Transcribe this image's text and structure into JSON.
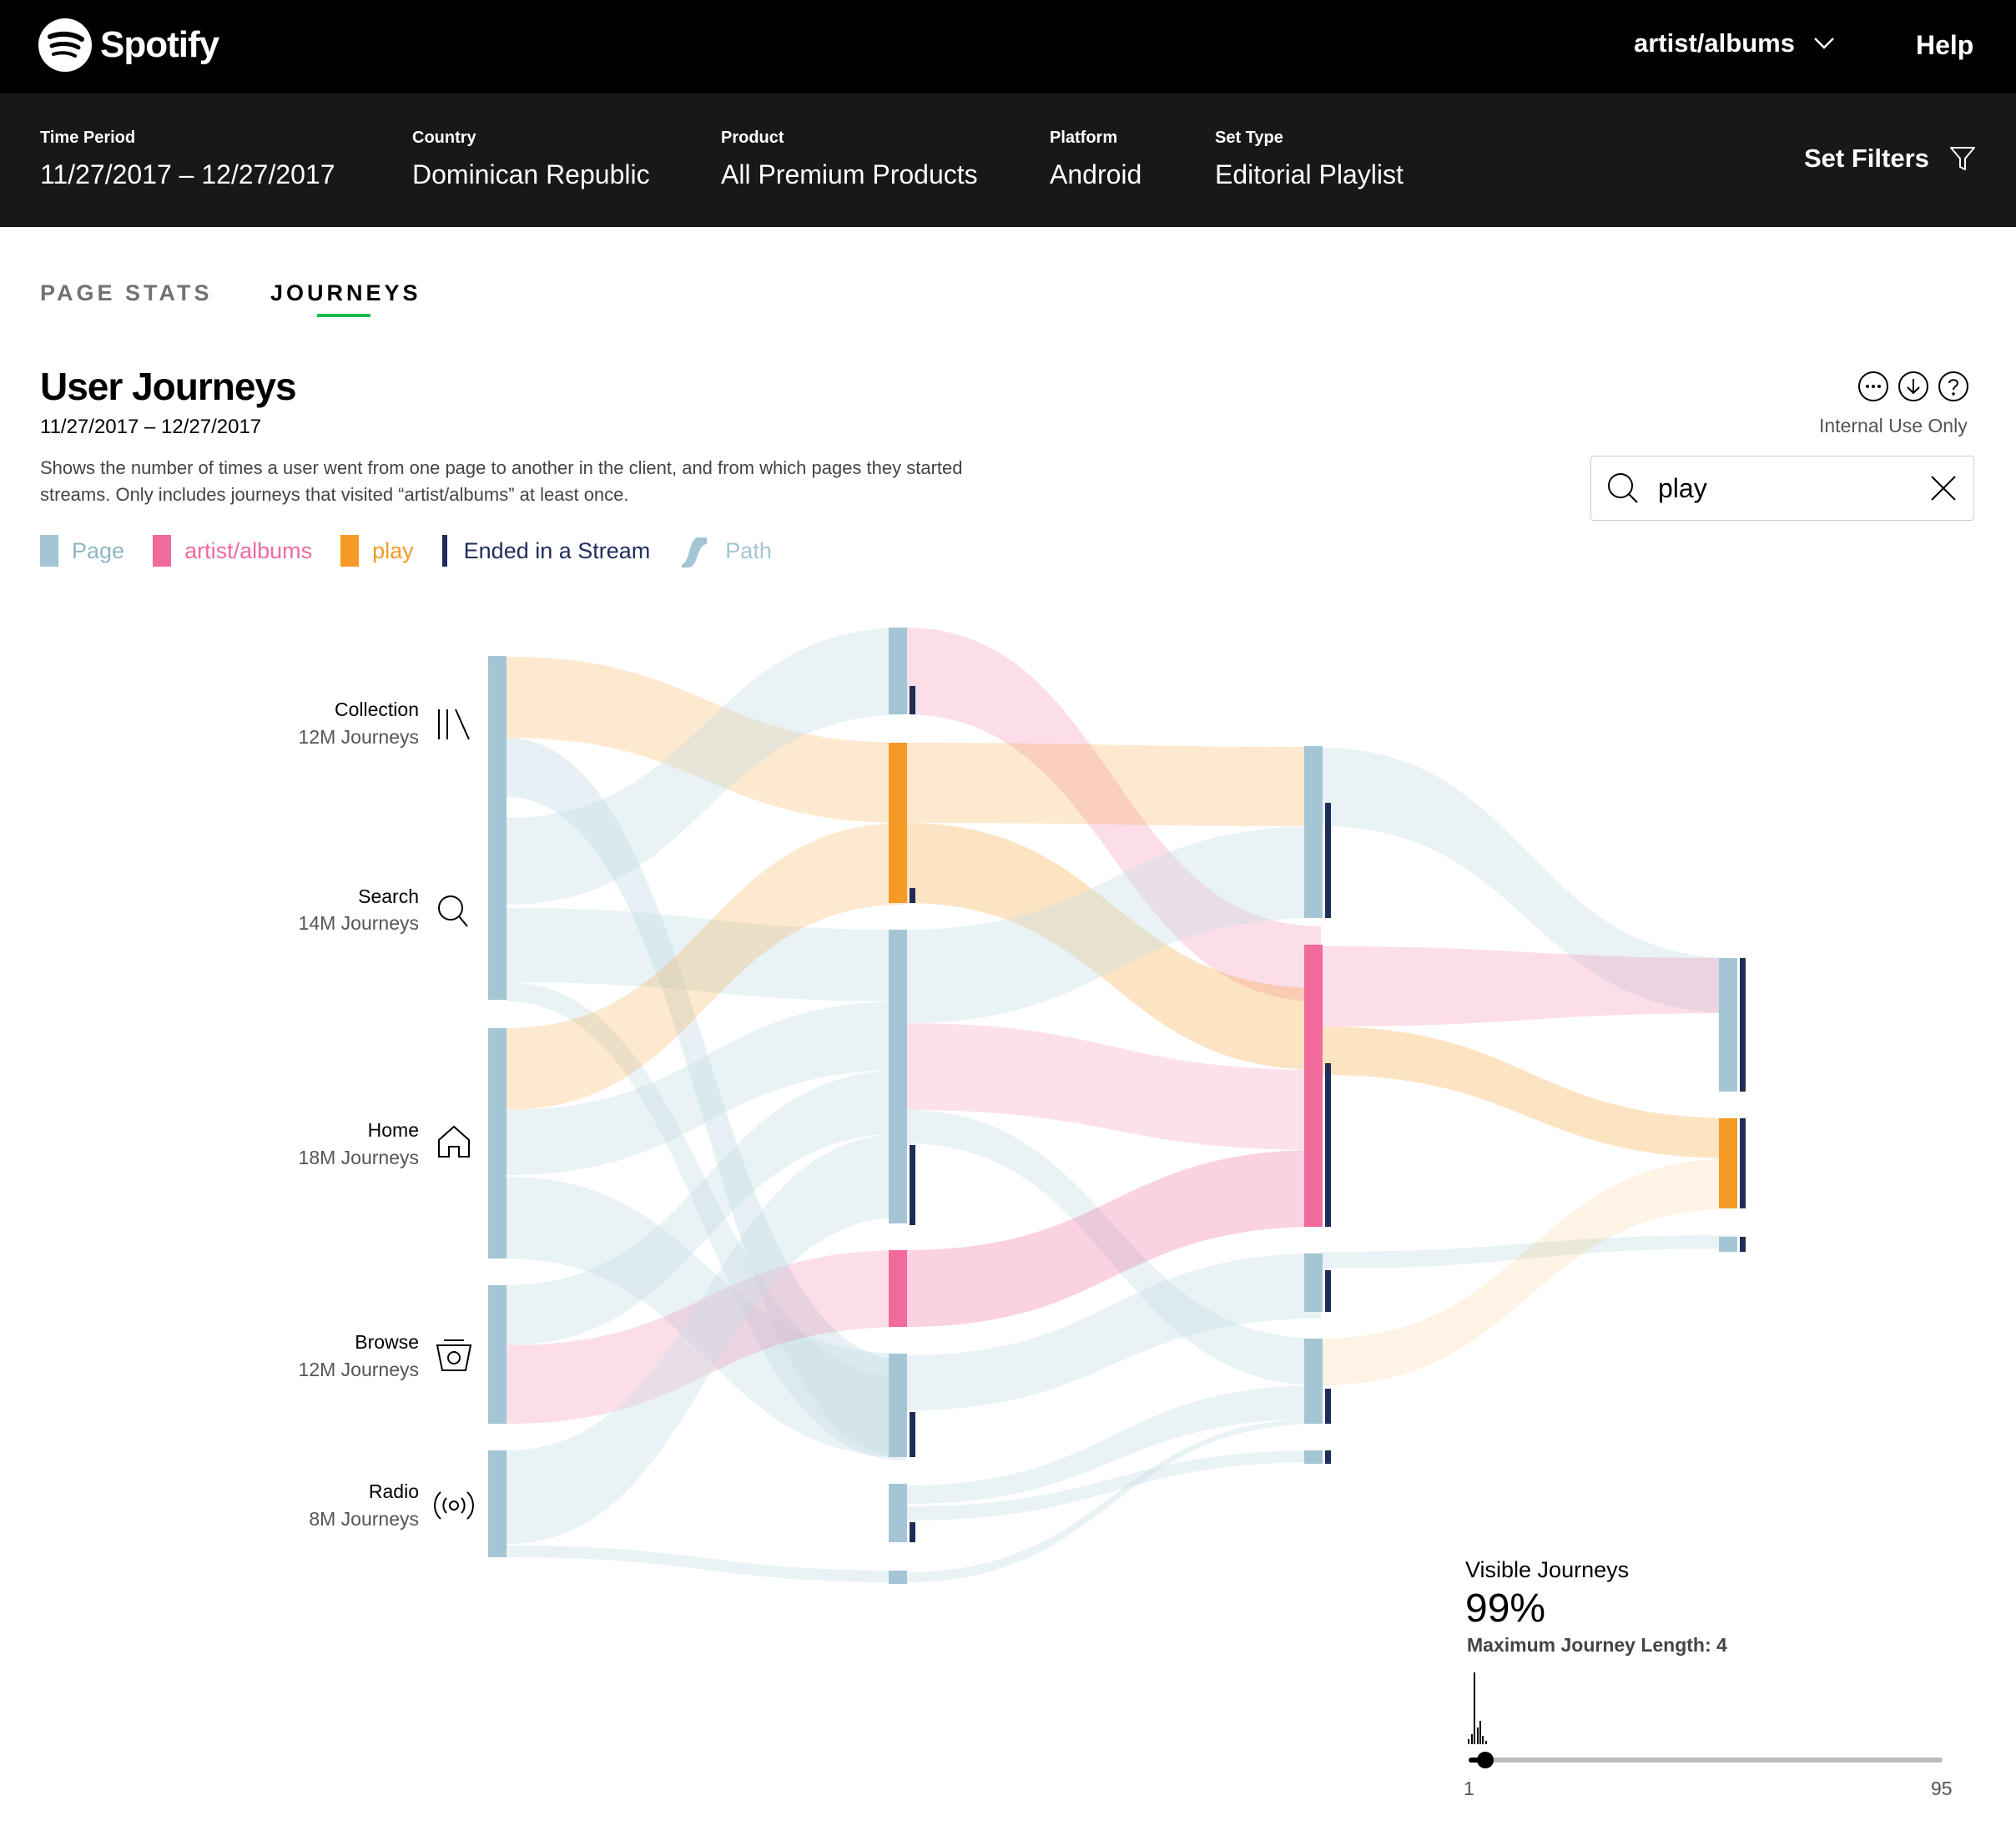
{
  "app": {
    "logo_text": "Spotify",
    "page_dropdown": "artist/albums",
    "help_label": "Help"
  },
  "filters": [
    {
      "label": "Time Period",
      "value": "11/27/2017 – 12/27/2017"
    },
    {
      "label": "Country",
      "value": "Dominican Republic"
    },
    {
      "label": "Product",
      "value": "All Premium Products"
    },
    {
      "label": "Platform",
      "value": "Android"
    },
    {
      "label": "Set Type",
      "value": "Editorial Playlist"
    }
  ],
  "set_filters_label": "Set Filters",
  "tabs": [
    {
      "label": "PAGE STATS",
      "active": false
    },
    {
      "label": "JOURNEYS",
      "active": true
    }
  ],
  "main": {
    "title": "User Journeys",
    "date_range": "11/27/2017 – 12/27/2017",
    "description": "Shows the number of times a user went from one page to another in the client, and from which pages they started streams. Only includes journeys that visited “artist/albums” at least once.",
    "internal_label": "Internal Use Only",
    "toolbar_icons": [
      "more-icon",
      "download-icon",
      "help-icon"
    ]
  },
  "search": {
    "value": "play"
  },
  "legend": [
    {
      "label": "Page",
      "color": "#a4c6d4",
      "kind": "block"
    },
    {
      "label": "artist/albums",
      "color": "#f06a9c",
      "kind": "block"
    },
    {
      "label": "play",
      "color": "#f59a25",
      "kind": "block"
    },
    {
      "label": "Ended in a Stream",
      "color": "#1e2d5a",
      "kind": "thin"
    },
    {
      "label": "Path",
      "color": "#a4c6d4",
      "kind": "path"
    }
  ],
  "colors": {
    "page": "#a4c6d4",
    "artist_albums": "#f06a9c",
    "play": "#f59a25",
    "stream": "#1e2d5a",
    "path": "#c9dee6",
    "accent": "#1DB954"
  },
  "sources": [
    {
      "name": "Collection",
      "journeys": "12M Journeys",
      "icon": "collection-icon"
    },
    {
      "name": "Search",
      "journeys": "14M Journeys",
      "icon": "search-icon"
    },
    {
      "name": "Home",
      "journeys": "18M Journeys",
      "icon": "home-icon"
    },
    {
      "name": "Browse",
      "journeys": "12M Journeys",
      "icon": "browse-icon"
    },
    {
      "name": "Radio",
      "journeys": "8M Journeys",
      "icon": "radio-icon"
    }
  ],
  "visible_journeys": {
    "title": "Visible Journeys",
    "percent": "99%",
    "max_length_label": "Maximum Journey Length: 4",
    "slider_min": "1",
    "slider_max": "95",
    "slider_value": 4
  }
}
